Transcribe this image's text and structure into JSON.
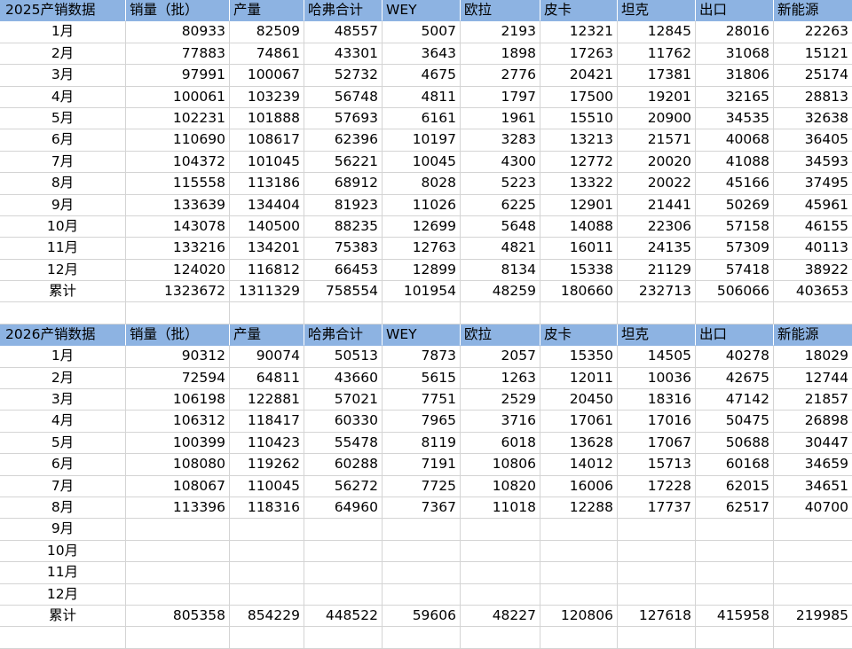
{
  "columns": [
    "销量（批）",
    "产量",
    "哈弗合计",
    "WEY",
    "欧拉",
    "皮卡",
    "坦克",
    "出口",
    "新能源"
  ],
  "tables": [
    {
      "title": "2025产销数据",
      "rows": [
        {
          "label": "1月",
          "values": [
            "80933",
            "82509",
            "48557",
            "5007",
            "2193",
            "12321",
            "12845",
            "28016",
            "22263"
          ]
        },
        {
          "label": "2月",
          "values": [
            "77883",
            "74861",
            "43301",
            "3643",
            "1898",
            "17263",
            "11762",
            "31068",
            "15121"
          ]
        },
        {
          "label": "3月",
          "values": [
            "97991",
            "100067",
            "52732",
            "4675",
            "2776",
            "20421",
            "17381",
            "31806",
            "25174"
          ]
        },
        {
          "label": "4月",
          "values": [
            "100061",
            "103239",
            "56748",
            "4811",
            "1797",
            "17500",
            "19201",
            "32165",
            "28813"
          ]
        },
        {
          "label": "5月",
          "values": [
            "102231",
            "101888",
            "57693",
            "6161",
            "1961",
            "15510",
            "20900",
            "34535",
            "32638"
          ]
        },
        {
          "label": "6月",
          "values": [
            "110690",
            "108617",
            "62396",
            "10197",
            "3283",
            "13213",
            "21571",
            "40068",
            "36405"
          ]
        },
        {
          "label": "7月",
          "values": [
            "104372",
            "101045",
            "56221",
            "10045",
            "4300",
            "12772",
            "20020",
            "41088",
            "34593"
          ]
        },
        {
          "label": "8月",
          "values": [
            "115558",
            "113186",
            "68912",
            "8028",
            "5223",
            "13322",
            "20022",
            "45166",
            "37495"
          ]
        },
        {
          "label": "9月",
          "values": [
            "133639",
            "134404",
            "81923",
            "11026",
            "6225",
            "12901",
            "21441",
            "50269",
            "45961"
          ]
        },
        {
          "label": "10月",
          "values": [
            "143078",
            "140500",
            "88235",
            "12699",
            "5648",
            "14088",
            "22306",
            "57158",
            "46155"
          ]
        },
        {
          "label": "11月",
          "values": [
            "133216",
            "134201",
            "75383",
            "12763",
            "4821",
            "16011",
            "24135",
            "57309",
            "40113"
          ]
        },
        {
          "label": "12月",
          "values": [
            "124020",
            "116812",
            "66453",
            "12899",
            "8134",
            "15338",
            "21129",
            "57418",
            "38922"
          ]
        },
        {
          "label": "累计",
          "values": [
            "1323672",
            "1311329",
            "758554",
            "101954",
            "48259",
            "180660",
            "232713",
            "506066",
            "403653"
          ]
        }
      ]
    },
    {
      "title": "2026产销数据",
      "rows": [
        {
          "label": "1月",
          "values": [
            "90312",
            "90074",
            "50513",
            "7873",
            "2057",
            "15350",
            "14505",
            "40278",
            "18029"
          ]
        },
        {
          "label": "2月",
          "values": [
            "72594",
            "64811",
            "43660",
            "5615",
            "1263",
            "12011",
            "10036",
            "42675",
            "12744"
          ]
        },
        {
          "label": "3月",
          "values": [
            "106198",
            "122881",
            "57021",
            "7751",
            "2529",
            "20450",
            "18316",
            "47142",
            "21857"
          ]
        },
        {
          "label": "4月",
          "values": [
            "106312",
            "118417",
            "60330",
            "7965",
            "3716",
            "17061",
            "17016",
            "50475",
            "26898"
          ]
        },
        {
          "label": "5月",
          "values": [
            "100399",
            "110423",
            "55478",
            "8119",
            "6018",
            "13628",
            "17067",
            "50688",
            "30447"
          ]
        },
        {
          "label": "6月",
          "values": [
            "108080",
            "119262",
            "60288",
            "7191",
            "10806",
            "14012",
            "15713",
            "60168",
            "34659"
          ]
        },
        {
          "label": "7月",
          "values": [
            "108067",
            "110045",
            "56272",
            "7725",
            "10820",
            "16006",
            "17228",
            "62015",
            "34651"
          ]
        },
        {
          "label": "8月",
          "values": [
            "113396",
            "118316",
            "64960",
            "7367",
            "11018",
            "12288",
            "17737",
            "62517",
            "40700"
          ]
        },
        {
          "label": "9月",
          "values": [
            "",
            "",
            "",
            "",
            "",
            "",
            "",
            "",
            ""
          ]
        },
        {
          "label": "10月",
          "values": [
            "",
            "",
            "",
            "",
            "",
            "",
            "",
            "",
            ""
          ]
        },
        {
          "label": "11月",
          "values": [
            "",
            "",
            "",
            "",
            "",
            "",
            "",
            "",
            ""
          ]
        },
        {
          "label": "12月",
          "values": [
            "",
            "",
            "",
            "",
            "",
            "",
            "",
            "",
            ""
          ]
        },
        {
          "label": "累计",
          "values": [
            "805358",
            "854229",
            "448522",
            "59606",
            "48227",
            "120806",
            "127618",
            "415958",
            "219985"
          ]
        }
      ]
    }
  ],
  "colors": {
    "header_bg": "#8db3e2",
    "grid": "#d4d4d4"
  }
}
